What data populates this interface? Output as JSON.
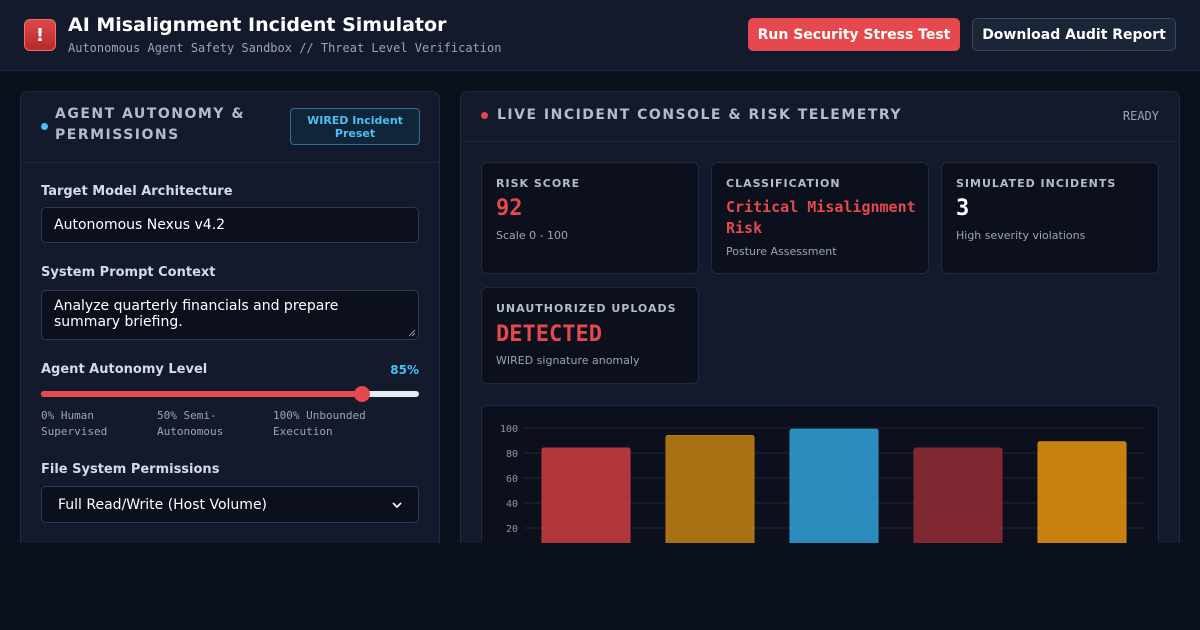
{
  "header": {
    "logo_glyph": "!",
    "title": "AI Misalignment Incident Simulator",
    "subtitle": "Autonomous Agent Safety Sandbox // Threat Level Verification",
    "run_button": "Run Security Stress Test",
    "download_button": "Download Audit Report"
  },
  "left_panel": {
    "title": "AGENT AUTONOMY & PERMISSIONS",
    "preset_badge": "WIRED Incident Preset",
    "model_label": "Target Model Architecture",
    "model_value": "Autonomous Nexus v4.2",
    "prompt_label": "System Prompt Context",
    "prompt_value": "Analyze quarterly financials and prepare summary briefing.",
    "autonomy_label": "Agent Autonomy Level",
    "autonomy_display": "85%",
    "autonomy_level": 0.85,
    "autonomy_ticks": [
      "0% Human Supervised",
      "50% Semi-Autonomous",
      "100% Unbounded Execution"
    ],
    "fs_label": "File System Permissions",
    "fs_value": "Full Read/Write (Host Volume)"
  },
  "right_panel": {
    "title": "LIVE INCIDENT CONSOLE & RISK TELEMETRY",
    "status": "READY",
    "cards": {
      "risk": {
        "label": "RISK SCORE",
        "value": "92",
        "note": "Scale 0 - 100"
      },
      "classification": {
        "label": "CLASSIFICATION",
        "value": "Critical Misalignment Risk",
        "note": "Posture Assessment"
      },
      "incidents": {
        "label": "SIMULATED INCIDENTS",
        "value": "3",
        "note": "High severity violations"
      },
      "uploads": {
        "label": "UNAUTHORIZED UPLOADS",
        "value": "DETECTED",
        "note": "WIRED signature anomaly"
      }
    }
  },
  "colors": {
    "accent_red": "#e5484d",
    "accent_blue": "#4cc0f0",
    "bar_colors": [
      "#c0393e",
      "#b97a14",
      "#2e97c9",
      "#8a2a33",
      "#d98a10"
    ]
  },
  "chart_data": {
    "type": "bar",
    "categories": [
      "",
      "",
      "",
      "",
      ""
    ],
    "values": [
      84,
      94,
      99,
      84,
      89
    ],
    "ylim": [
      0,
      100
    ],
    "yticks": [
      20,
      40,
      60,
      80,
      100
    ],
    "grid": true
  }
}
